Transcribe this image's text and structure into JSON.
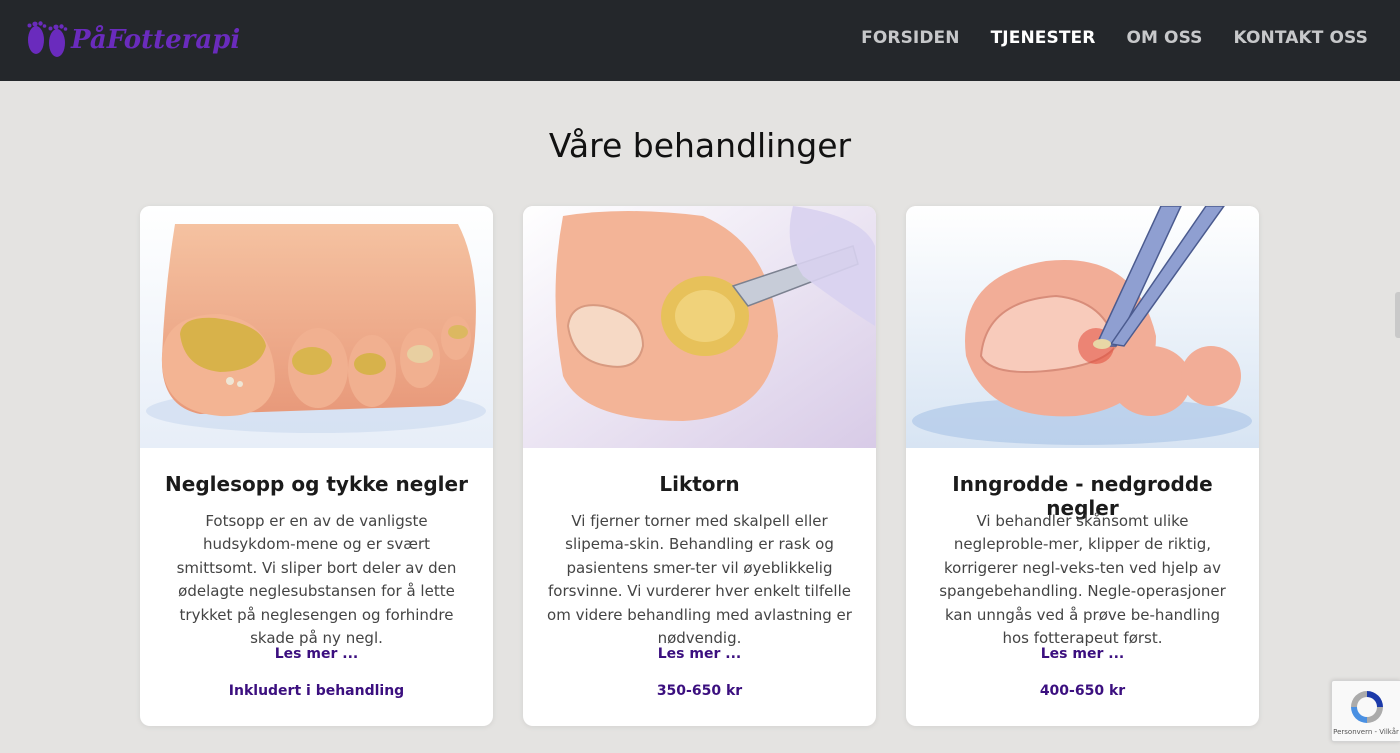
{
  "header": {
    "logo_text": "PåFotterapi",
    "nav": [
      {
        "label": "FORSIDEN",
        "active": false
      },
      {
        "label": "TJENESTER",
        "active": true
      },
      {
        "label": "OM OSS",
        "active": false
      },
      {
        "label": "KONTAKT OSS",
        "active": false
      }
    ]
  },
  "main": {
    "title": "Våre behandlinger",
    "cards": [
      {
        "title": "Neglesopp og tykke negler",
        "description": "Fotsopp er en av de vanligste hudsykdom-mene og er svært smittsomt. Vi sliper bort deler av den ødelagte neglesubstansen for å lette trykket på neglesengen og forhindre skade på ny negl.",
        "link": "Les mer ...",
        "price": "Inkludert i behandling",
        "image": "illustration-toenail-fungus"
      },
      {
        "title": "Liktorn",
        "description": "Vi fjerner torner med skalpell eller slipema-skin. Behandling er rask og pasientens smer-ter vil øyeblikkelig forsvinne. Vi vurderer hver enkelt tilfelle om videre behandling med avlastning er nødvendig.",
        "link": "Les mer ...",
        "price": "350-650 kr",
        "image": "illustration-corn-removal"
      },
      {
        "title": "Inngrodde - nedgrodde negler",
        "description": "Vi behandler skånsomt ulike negleproble-mer, klipper de riktig, korrigerer negl-veks-ten ved hjelp av spangebehandling. Negle-operasjoner kan unngås ved å prøve be-handling hos fotterapeut først.",
        "link": "Les mer ...",
        "price": "400-650 kr",
        "image": "illustration-ingrown-nail"
      }
    ]
  },
  "recaptcha": {
    "label": "Personvern - Vilkår",
    "icon": "recaptcha-icon"
  },
  "colors": {
    "header_bg": "#24272b",
    "page_bg": "#e4e3e1",
    "brand_purple": "#6a2bbd",
    "link_purple": "#3b0f7f"
  }
}
